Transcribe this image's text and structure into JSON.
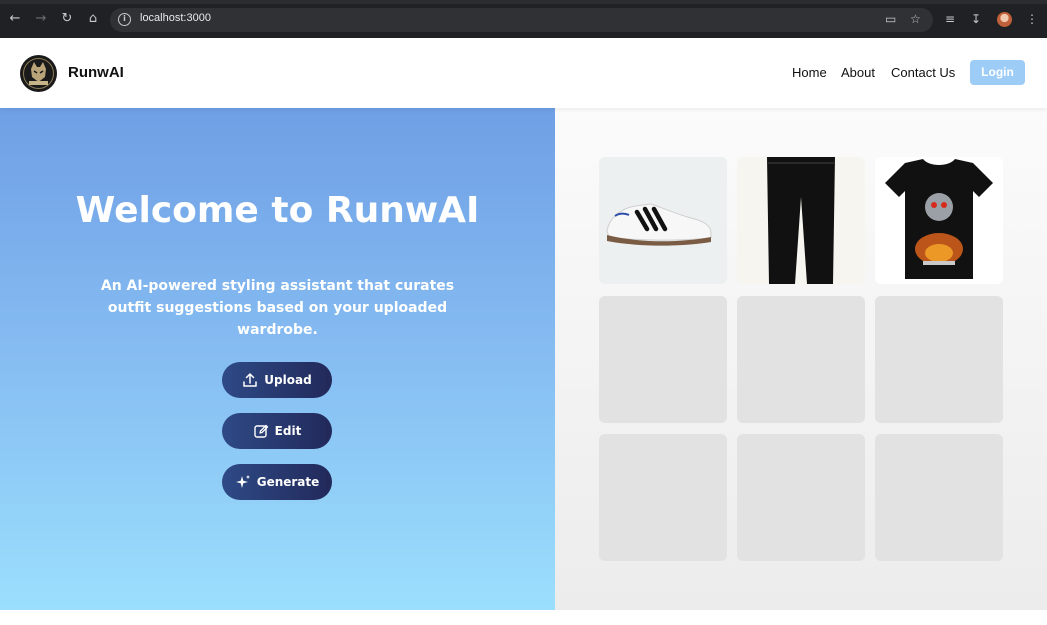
{
  "browser": {
    "url": "localhost:3000"
  },
  "header": {
    "brand": "RunwAI",
    "nav": [
      "Home",
      "About",
      "Contact Us"
    ],
    "login_label": "Login"
  },
  "hero": {
    "title": "Welcome to RunwAI",
    "subtitle": "An AI-powered styling assistant that curates outfit suggestions based on your uploaded wardrobe.",
    "buttons": {
      "upload": "Upload",
      "edit": "Edit",
      "generate": "Generate"
    }
  },
  "wardrobe": {
    "items": [
      "sneaker",
      "black-pants",
      "black-tshirt",
      "empty",
      "empty",
      "empty",
      "empty",
      "empty",
      "empty"
    ]
  }
}
